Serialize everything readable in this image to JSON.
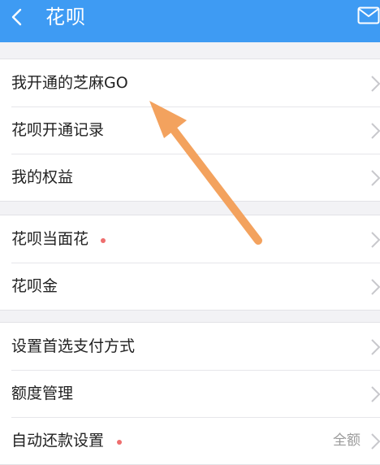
{
  "header": {
    "title": "花呗",
    "back_icon": "chevron-left-icon",
    "mail_icon": "envelope-icon",
    "background": "#3e9bf3"
  },
  "groups": [
    {
      "items": [
        {
          "label": "我开通的芝麻GO",
          "has_dot": false,
          "value": ""
        },
        {
          "label": "花呗开通记录",
          "has_dot": false,
          "value": ""
        },
        {
          "label": "我的权益",
          "has_dot": false,
          "value": ""
        }
      ]
    },
    {
      "items": [
        {
          "label": "花呗当面花",
          "has_dot": true,
          "value": ""
        },
        {
          "label": "花呗金",
          "has_dot": false,
          "value": ""
        }
      ]
    },
    {
      "items": [
        {
          "label": "设置首选支付方式",
          "has_dot": false,
          "value": ""
        },
        {
          "label": "额度管理",
          "has_dot": false,
          "value": ""
        },
        {
          "label": "自动还款设置",
          "has_dot": true,
          "value": "全额"
        }
      ]
    }
  ],
  "annotation": {
    "type": "arrow",
    "color": "#f3a25e",
    "points_to": "我开通的芝麻GO"
  },
  "colors": {
    "dot": "#ee6e6e",
    "chevron": "#c8c8cc",
    "divider": "#e6e6ea"
  }
}
